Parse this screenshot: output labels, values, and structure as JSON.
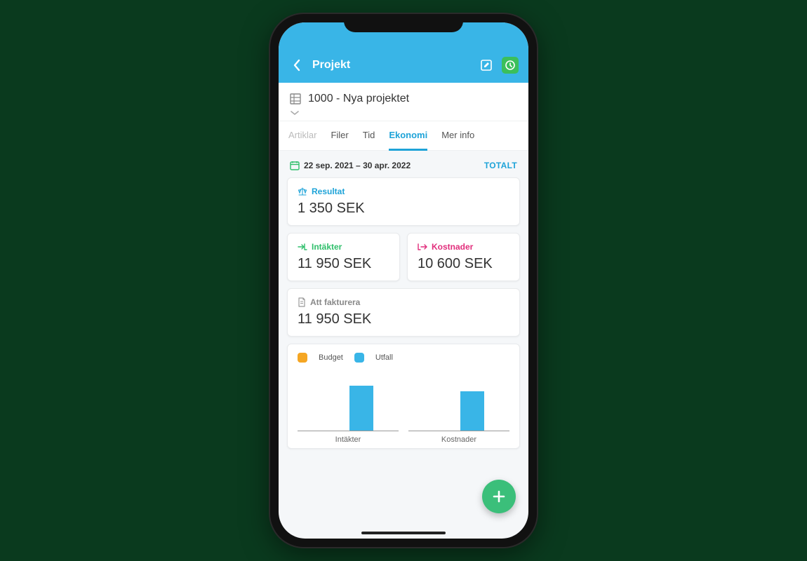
{
  "header": {
    "title": "Projekt"
  },
  "project": {
    "name": "1000 - Nya projektet"
  },
  "tabs": {
    "items": [
      {
        "label": "Artiklar",
        "state": "muted"
      },
      {
        "label": "Filer",
        "state": "normal"
      },
      {
        "label": "Tid",
        "state": "normal"
      },
      {
        "label": "Ekonomi",
        "state": "active"
      },
      {
        "label": "Mer info",
        "state": "normal"
      }
    ]
  },
  "date_range": "22 sep. 2021 – 30 apr. 2022",
  "total_label": "TOTALT",
  "cards": {
    "resultat": {
      "label": "Resultat",
      "value": "1 350 SEK"
    },
    "intakter": {
      "label": "Intäkter",
      "value": "11 950 SEK"
    },
    "kostnader": {
      "label": "Kostnader",
      "value": "10 600 SEK"
    },
    "att_fakturera": {
      "label": "Att fakturera",
      "value": "11 950 SEK"
    }
  },
  "chart_legend": {
    "budget": "Budget",
    "utfall": "Utfall"
  },
  "chart_data": {
    "type": "bar",
    "categories": [
      "Intäkter",
      "Kostnader"
    ],
    "series": [
      {
        "name": "Budget",
        "values": [
          0,
          0
        ],
        "color": "#f5a623"
      },
      {
        "name": "Utfall",
        "values": [
          11950,
          10600
        ],
        "color": "#39b5e7"
      }
    ],
    "ylim": [
      0,
      13000
    ],
    "xlabel": "",
    "ylabel": ""
  },
  "colors": {
    "primary": "#39b5e7",
    "green": "#2fbf6b",
    "pink": "#e12d7b",
    "orange": "#f5a623",
    "fab": "#3bbf7a"
  }
}
